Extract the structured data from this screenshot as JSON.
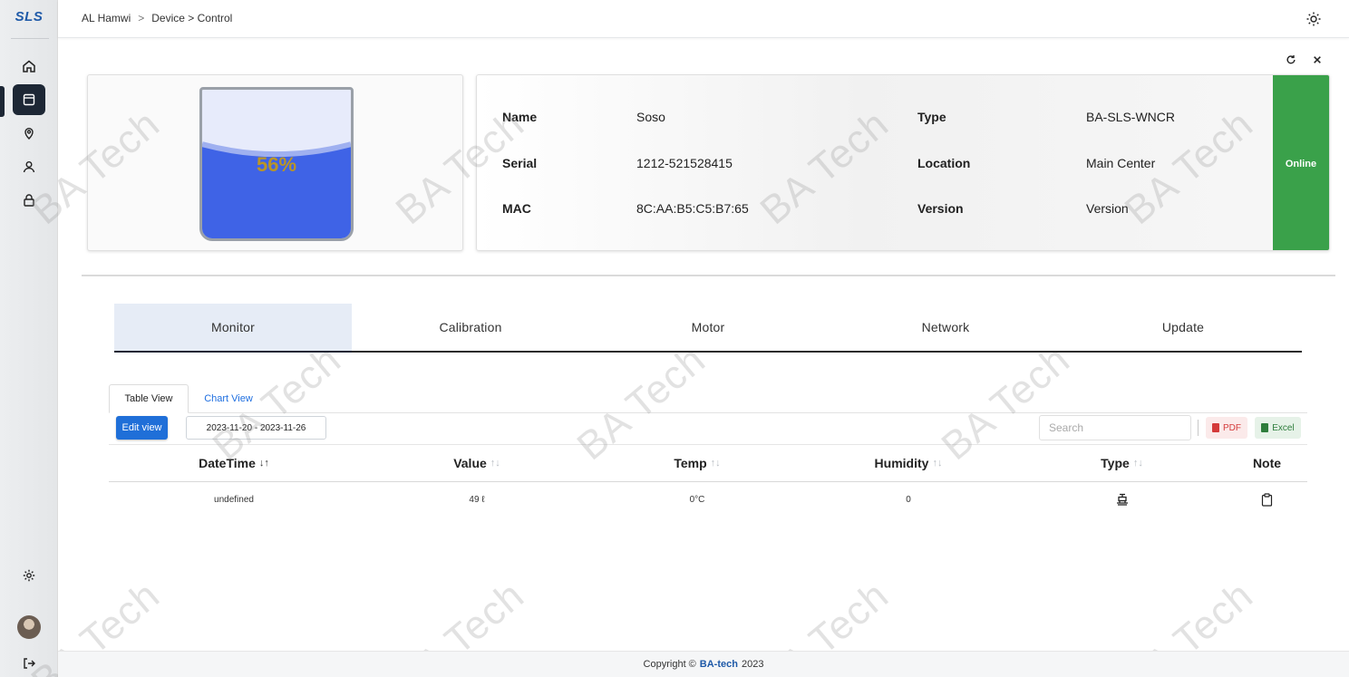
{
  "app": {
    "logo": "SLS"
  },
  "breadcrumb": {
    "user": "AL Hamwi",
    "separator": ">",
    "path": "Device > Control"
  },
  "device": {
    "level_percent": "56%",
    "level_fraction": 0.56,
    "fields": {
      "name_label": "Name",
      "name_value": "Soso",
      "serial_label": "Serial",
      "serial_value": "1212-521528415",
      "mac_label": "MAC",
      "mac_value": "8C:AA:B5:C5:B7:65",
      "type_label": "Type",
      "type_value": "BA-SLS-WNCR",
      "location_label": "Location",
      "location_value": "Main Center",
      "version_label": "Version",
      "version_value": "Version"
    },
    "status": "Online",
    "status_color": "#3aa14a"
  },
  "tabs": [
    "Monitor",
    "Calibration",
    "Motor",
    "Network",
    "Update"
  ],
  "subtabs": {
    "table": "Table View",
    "chart": "Chart View"
  },
  "toolbar": {
    "edit_label": "Edit view",
    "date_range": "2023-11-20 - 2023-11-26",
    "search_placeholder": "Search",
    "pdf_label": "PDF",
    "excel_label": "Excel"
  },
  "table": {
    "headers": [
      "DateTime",
      "Value",
      "Temp",
      "Humidity",
      "Type",
      "Note"
    ],
    "sort_active": "↓↑",
    "sort_idle": "↑↓",
    "rows": [
      {
        "datetime": "undefined",
        "value": "49 ℓ",
        "temp": "0°C",
        "humidity": "0",
        "type_icon": "pump-icon",
        "note_icon": "clipboard-icon"
      }
    ]
  },
  "watermark": "BA Tech",
  "footer": {
    "prefix": "Copyright ©",
    "brand": "BA-tech",
    "year": "2023"
  },
  "colors": {
    "accent": "#1f6fd8",
    "sidebar_active": "#1d2735",
    "online": "#3aa14a",
    "water": "#3f63e6"
  }
}
